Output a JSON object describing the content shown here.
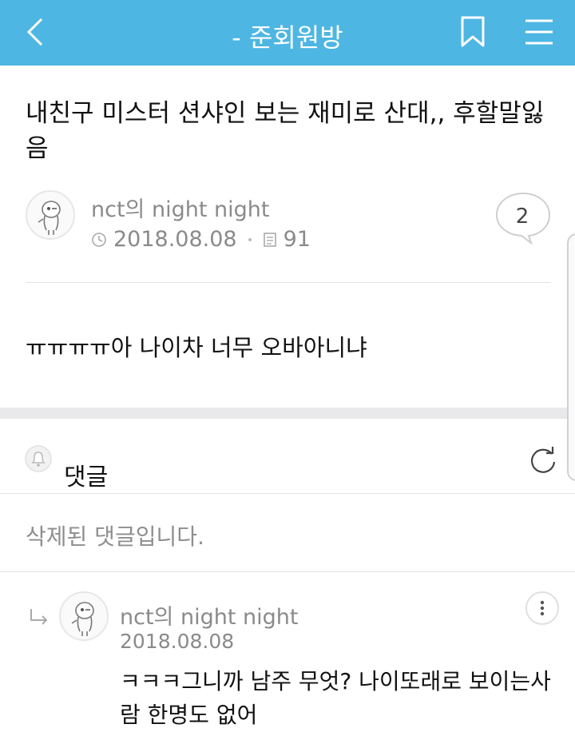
{
  "header": {
    "title": "-  준회원방",
    "back_icon": "chevron-left-icon",
    "bookmark_icon": "bookmark-icon",
    "menu_icon": "hamburger-menu-icon",
    "bar_color": "#4db6e3"
  },
  "post": {
    "title": "내친구 미스터 션샤인 보는 재미로 산대,, 후할말잃음",
    "author": "nct의 night night",
    "date": "2018.08.08",
    "views": "91",
    "comment_count": "2",
    "body": "ㅠㅠㅠㅠ아 나이차 너무 오바아니냐"
  },
  "comments": {
    "label": "댓글",
    "deleted_text": "삭제된 댓글입니다.",
    "reply": {
      "author": "nct의 night night",
      "date": "2018.08.08",
      "text": "ㅋㅋㅋ그니까 남주 무엇? 나이또래로 보이는사람 한명도 없어"
    }
  }
}
